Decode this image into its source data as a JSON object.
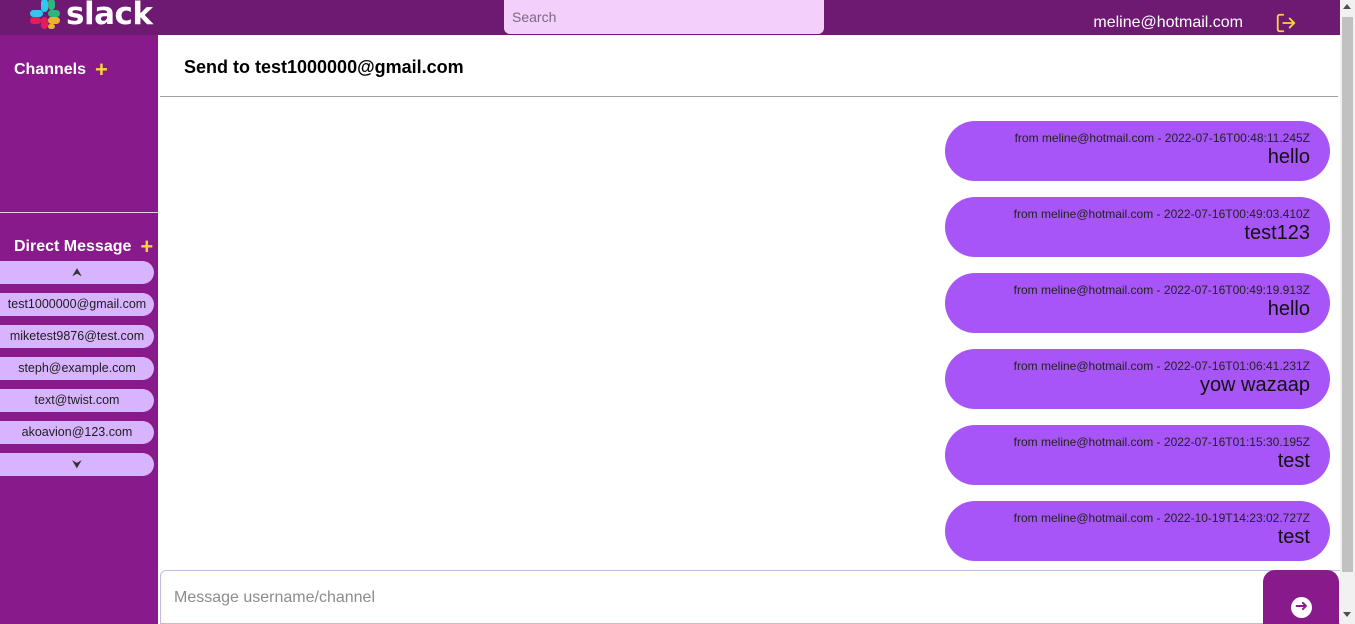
{
  "app": {
    "logo_text": "slack",
    "user_email": "meline@hotmail.com",
    "search_placeholder": "Search",
    "logout_icon": "logout-icon"
  },
  "sidebar": {
    "channels_label": "Channels",
    "channels_add": "+",
    "dm_label": "Direct Message",
    "dm_add": "+",
    "dm_scroll_up": "⮝",
    "dm_scroll_down": "⮟",
    "dm_items": [
      {
        "label": "test1000000@gmail.com"
      },
      {
        "label": "miketest9876@test.com"
      },
      {
        "label": "steph@example.com"
      },
      {
        "label": "text@twist.com"
      },
      {
        "label": "akoavion@123.com"
      }
    ]
  },
  "main": {
    "title": "Send to test1000000@gmail.com",
    "messages": [
      {
        "meta": "from meline@hotmail.com - 2022-07-16T00:48:11.245Z",
        "text": "hello"
      },
      {
        "meta": "from meline@hotmail.com - 2022-07-16T00:49:03.410Z",
        "text": "test123"
      },
      {
        "meta": "from meline@hotmail.com - 2022-07-16T00:49:19.913Z",
        "text": "hello"
      },
      {
        "meta": "from meline@hotmail.com - 2022-07-16T01:06:41.231Z",
        "text": "yow wazaap"
      },
      {
        "meta": "from meline@hotmail.com - 2022-07-16T01:15:30.195Z",
        "text": "test"
      },
      {
        "meta": "from meline@hotmail.com - 2022-10-19T14:23:02.727Z",
        "text": "test"
      }
    ],
    "composer_placeholder": "Message username/channel",
    "send_icon": "arrow-right-circle-icon"
  },
  "colors": {
    "topbar": "#6e1a73",
    "sidebar": "#891a8c",
    "accent_yellow": "#f7d33f",
    "message_bubble": "#a855f7",
    "dm_pill": "#d8b4fe",
    "search_bg": "#f2d0fb"
  }
}
